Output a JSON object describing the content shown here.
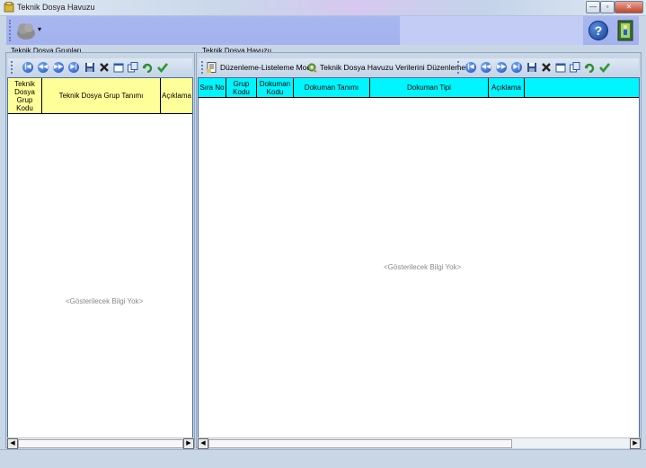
{
  "window": {
    "title": "Teknik Dosya Havuzu",
    "minimize_glyph": "—",
    "restore_glyph": "▫",
    "close_glyph": "✕"
  },
  "topbar": {
    "help_glyph": "?",
    "logo_dropdown_glyph": "▾"
  },
  "left_panel": {
    "title": "Teknik Dosya Grupları",
    "columns": [
      "Teknik Dosya Grup Kodu",
      "Teknik Dosya Grup Tanımı",
      "Açıklama"
    ],
    "empty_message": "<Gösterilecek Bilgi Yok>"
  },
  "right_panel": {
    "title": "Teknik Dosya Havuzu",
    "mode_button_label": "Düzenleme-Listeleme Modu",
    "edit_button_label": "Teknik Dosya Havuzu Verilerini Düzenleme",
    "columns": [
      "Sıra No",
      "Grup Kodu",
      "Dokuman Kodu",
      "Dokuman Tanımı",
      "Dokuman Tipi",
      "Açıklama"
    ],
    "empty_message": "<Gösterilecek Bilgi Yok>"
  },
  "nav_glyphs": {
    "first": "|◀",
    "prev_page": "◀◀",
    "next_page": "▶▶",
    "last": "▶|"
  },
  "scroll_glyphs": {
    "left": "◀",
    "right": "▶"
  },
  "colors": {
    "left_header_bg": "#ffff99",
    "right_header_bg": "#00f5ff",
    "toolbar_bg": "#a9b7f0"
  }
}
